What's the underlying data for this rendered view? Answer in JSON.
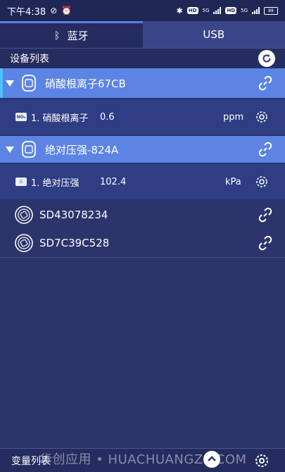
{
  "status_bar": {
    "time": "下午4:38",
    "network_left": "5G",
    "network_right": "5G",
    "battery": "88"
  },
  "tabs": {
    "bluetooth": "蓝牙",
    "usb": "USB"
  },
  "device_list_title": "设备列表",
  "devices": [
    {
      "name": "硝酸根离子67CB",
      "sub_badge": "NO₃",
      "sub_label": "1. 硝酸根离子",
      "sub_value": "0.6",
      "sub_unit": "ppm"
    },
    {
      "name": "绝对压强-824A",
      "sub_badge": "☷",
      "sub_label": "1. 绝对压强",
      "sub_value": "102.4",
      "sub_unit": "kPa"
    },
    {
      "name": "SD43078234"
    },
    {
      "name": "SD7C39C528"
    }
  ],
  "bottom": {
    "variable_list": "变量列表",
    "watermark": "华创应用 • HUACHUANGZS.COM"
  }
}
